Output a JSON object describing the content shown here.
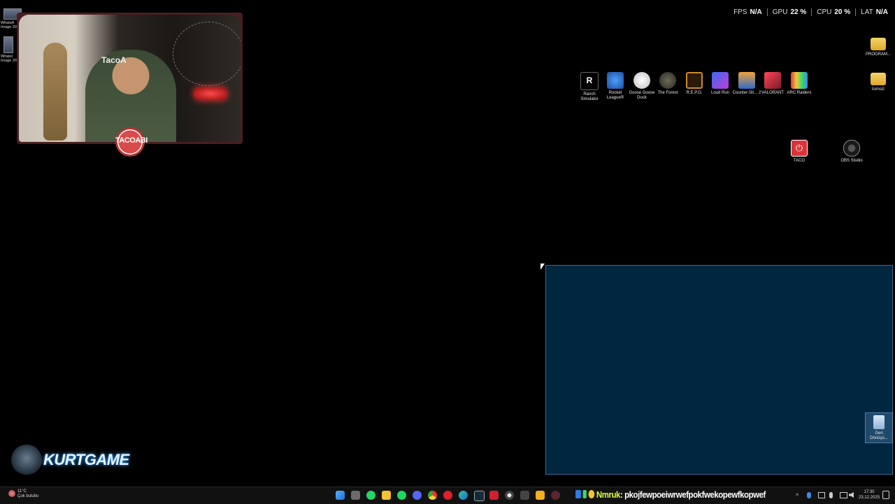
{
  "hud": {
    "fps_label": "FPS",
    "fps_value": "N/A",
    "gpu_label": "GPU",
    "gpu_value": "22 %",
    "cpu_label": "CPU",
    "cpu_value": "20 %",
    "lat_label": "LAT",
    "lat_value": "N/A"
  },
  "left_icons": [
    {
      "label": "WhatsA Image 20",
      "icon": "image-file-icon"
    },
    {
      "label": "Whatsl Image 20",
      "icon": "image-file-icon"
    }
  ],
  "desktop_icons": [
    {
      "label": "Ranch Simulator",
      "icon": "ranch-simulator-icon",
      "color": "#000000"
    },
    {
      "label": "Rocket League®",
      "icon": "rocket-league-icon",
      "color": "#1e66c9"
    },
    {
      "label": "Goose Goose Duck",
      "icon": "goose-goose-duck-icon",
      "color": "#d9d9d9"
    },
    {
      "label": "The Forest",
      "icon": "the-forest-icon",
      "color": "#555544"
    },
    {
      "label": "R.E.P.O.",
      "icon": "repo-icon",
      "color": "#d08a2a"
    },
    {
      "label": "Loud Run",
      "icon": "loud-run-icon",
      "color": "#6a3cc9"
    },
    {
      "label": "Counter-Str... 2",
      "icon": "counter-strike-icon",
      "color": "#e28b1a"
    },
    {
      "label": "VALORANT",
      "icon": "valorant-icon",
      "color": "#d9344a"
    },
    {
      "label": "ARC Raiders",
      "icon": "arc-raiders-icon",
      "color": "#222222"
    }
  ],
  "right_icons": [
    {
      "label": "PROGRAM...",
      "icon": "folder-icon"
    },
    {
      "label": "İsimsiz",
      "icon": "folder-icon"
    }
  ],
  "shortcut_icons": [
    {
      "label": "TACO",
      "icon": "power-icon"
    },
    {
      "label": "OBS Studio",
      "icon": "obs-icon"
    }
  ],
  "recycle_bin": {
    "label": "Geri Dönüşü...",
    "icon": "recycle-bin-icon"
  },
  "webcam": {
    "badge": "TACOABI",
    "chair_text": "TacoA"
  },
  "logo": {
    "text": "KURTGAME"
  },
  "taskbar": {
    "weather_temp": "11°C",
    "weather_desc": "Çok bulutlu",
    "ticker_name": "Nmruk",
    "ticker_text": ": pkojfewpoeiwrwefpokfwekopewfkopwef",
    "time": "17:30",
    "date": "23.12.2025",
    "tray_chevron": "^",
    "colors": {
      "start": "#3b9cf2",
      "app_green": "#25d366",
      "spotify": "#1ed760",
      "files": "#f2c230",
      "opera": "#e0202f",
      "edge": "#2fa7d6",
      "chrome": "#e8b53b"
    }
  }
}
